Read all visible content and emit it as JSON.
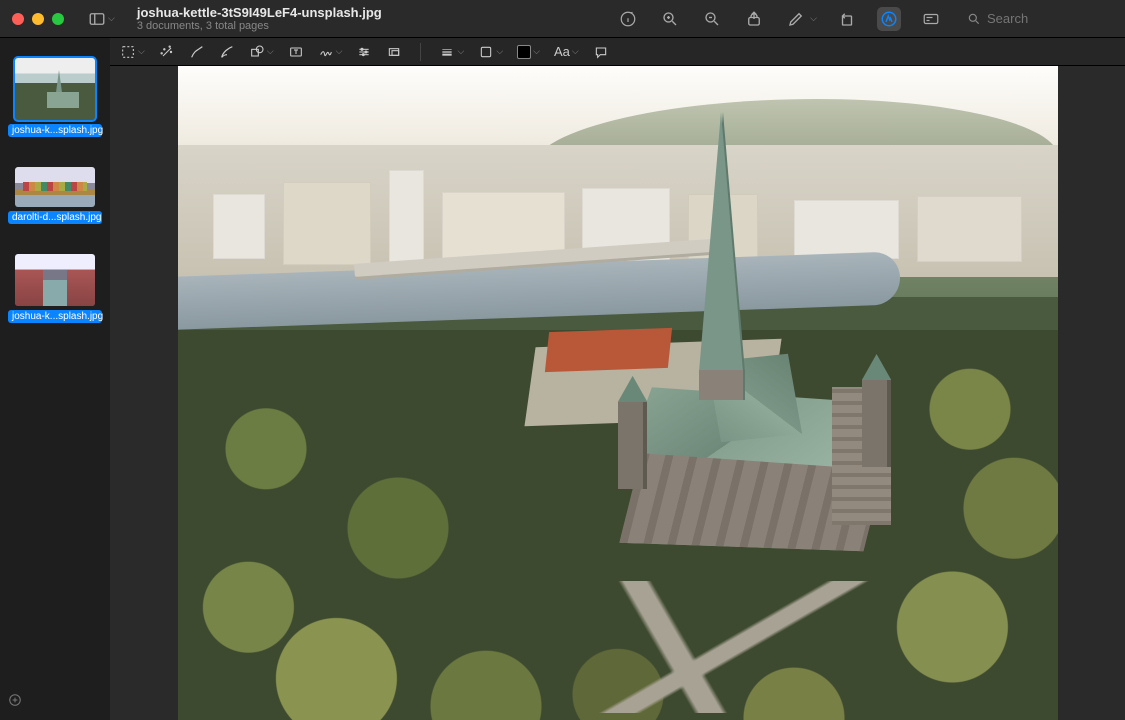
{
  "window": {
    "title": "joshua-kettle-3tS9I49LeF4-unsplash.jpg",
    "subtitle": "3 documents, 3 total pages"
  },
  "search": {
    "placeholder": "Search"
  },
  "thumbnails": [
    {
      "label": "joshua-k...splash.jpg",
      "selected": true
    },
    {
      "label": "darolti-d...splash.jpg",
      "selected": false
    },
    {
      "label": "joshua-k...splash.jpg",
      "selected": false
    }
  ],
  "markup": {
    "text_style_label": "Aa"
  }
}
